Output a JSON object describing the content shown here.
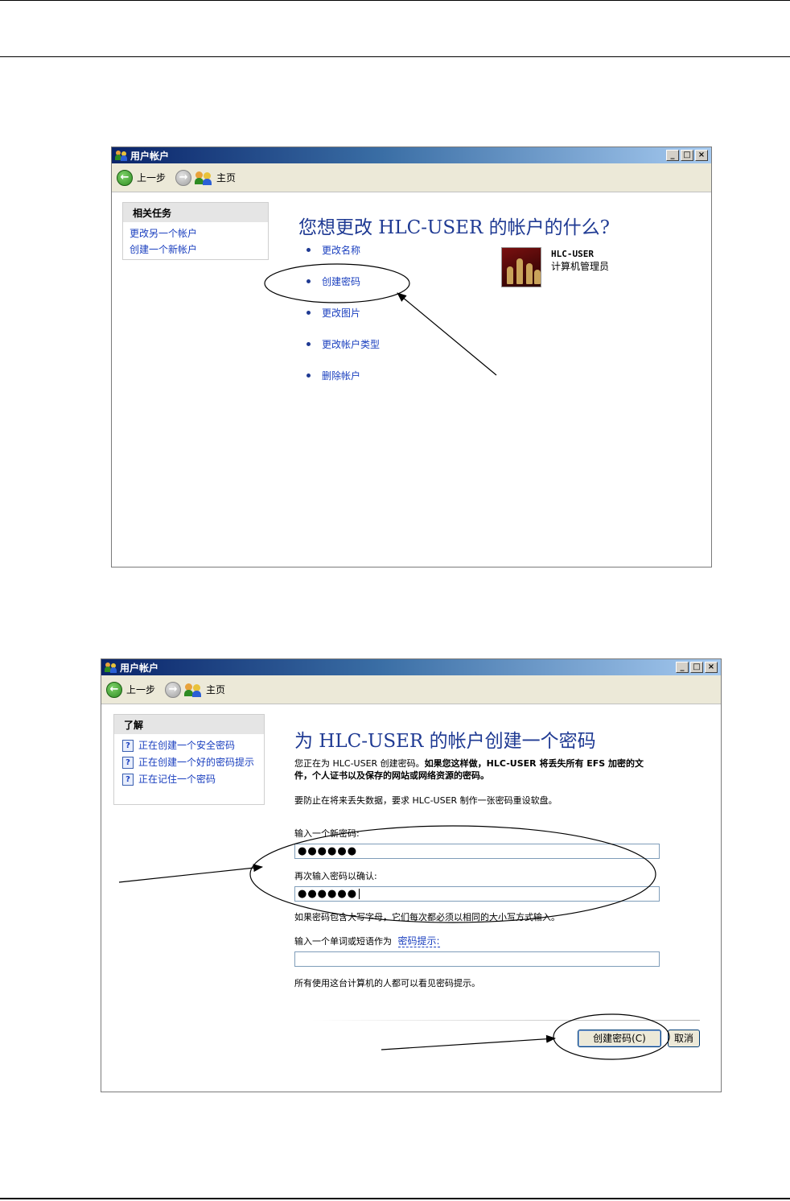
{
  "window1": {
    "title": "用户帐户",
    "toolbar": {
      "back": "上一步",
      "home": "主页"
    },
    "tasks_header": "相关任务",
    "tasks": [
      "更改另一个帐户",
      "创建一个新帐户"
    ],
    "heading": "您想更改 HLC-USER 的帐户的什么?",
    "options": [
      "更改名称",
      "创建密码",
      "更改图片",
      "更改帐户类型",
      "删除帐户"
    ],
    "account": {
      "name": "HLC-USER",
      "type": "计算机管理员"
    }
  },
  "window2": {
    "title": "用户帐户",
    "toolbar": {
      "back": "上一步",
      "home": "主页"
    },
    "learn_header": "了解",
    "learn_links": [
      "正在创建一个安全密码",
      "正在创建一个好的密码提示",
      "正在记住一个密码"
    ],
    "heading": "为 HLC-USER 的帐户创建一个密码",
    "intro_normal": "您正在为 HLC-USER 创建密码。",
    "intro_bold": "如果您这样做，HLC-USER 将丢失所有 EFS 加密的文件，个人证书以及保存的网站或网络资源的密码。",
    "prevent_text": "要防止在将来丢失数据，要求 HLC-USER 制作一张密码重设软盘。",
    "new_password_label": "输入一个新密码:",
    "new_password_value": "●●●●●●",
    "confirm_label": "再次输入密码以确认:",
    "confirm_value": "●●●●●●",
    "case_note": "如果密码包含大写字母，它们每次都必须以相同的大小写方式输入。",
    "hint_label": "输入一个单词或短语作为",
    "hint_link": "密码提示:",
    "hint_value": "",
    "hint_note": "所有使用这台计算机的人都可以看见密码提示。",
    "create_button": "创建密码(C)",
    "cancel_button": "取消"
  },
  "colors": {
    "title_bar": "#0a246a",
    "link": "#1a3fbf",
    "heading": "#1f3a93"
  }
}
